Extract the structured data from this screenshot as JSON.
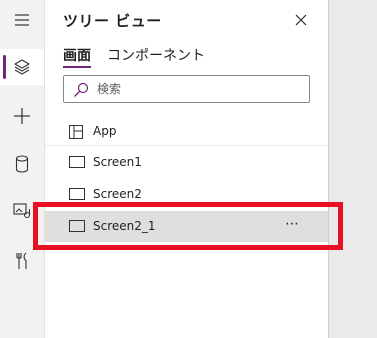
{
  "rail": {
    "items": [
      {
        "icon": "hamburger-menu-icon"
      },
      {
        "icon": "layers-icon",
        "active": true
      },
      {
        "icon": "plus-icon"
      },
      {
        "icon": "database-icon"
      },
      {
        "icon": "media-icon"
      },
      {
        "icon": "tools-icon"
      }
    ],
    "accent": "#742774"
  },
  "panel": {
    "title": "ツリー ビュー",
    "tabs": [
      {
        "label": "画面",
        "selected": true
      },
      {
        "label": "コンポーネント",
        "selected": false
      }
    ],
    "search": {
      "placeholder": "検索",
      "value": ""
    },
    "tree": [
      {
        "label": "App",
        "icon": "app-icon"
      },
      {
        "label": "Screen1",
        "icon": "screen-icon"
      },
      {
        "label": "Screen2",
        "icon": "screen-icon"
      },
      {
        "label": "Screen2_1",
        "icon": "screen-icon",
        "selected": true,
        "more": "⋯"
      }
    ]
  },
  "annotation": {
    "color": "#e81123"
  }
}
